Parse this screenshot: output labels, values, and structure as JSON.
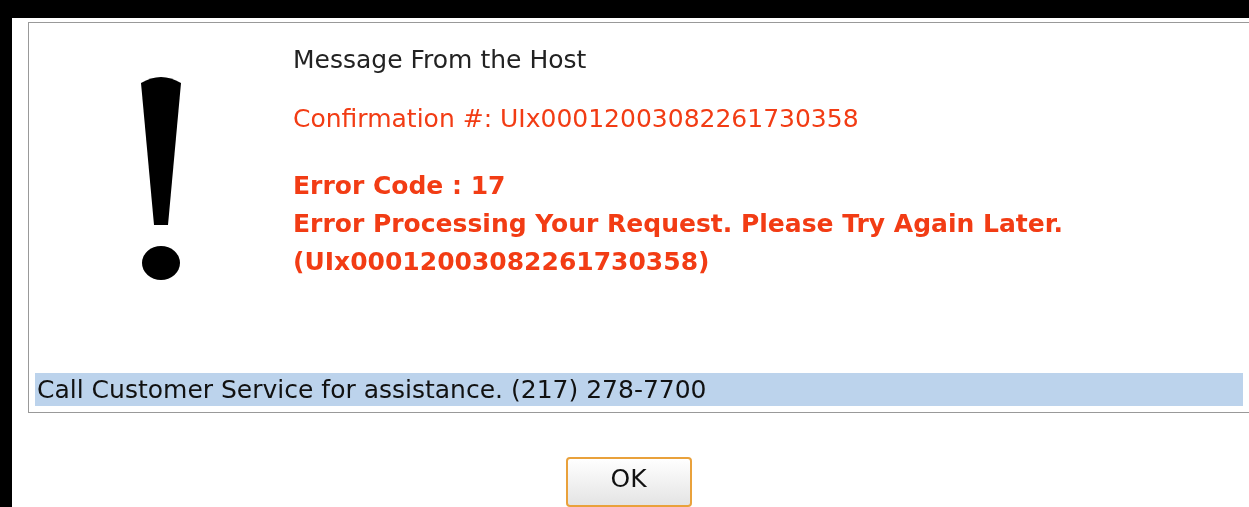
{
  "dialog": {
    "title": "Message From the Host",
    "confirmation": "Confirmation #: UIx00012003082261730358",
    "error_code": "Error Code : 17",
    "error_message": "Error Processing Your Request. Please Try Again Later. (UIx00012003082261730358)",
    "footer": "Call Customer Service for assistance. (217) 278-7700"
  },
  "buttons": [
    {
      "label": "OK"
    }
  ]
}
